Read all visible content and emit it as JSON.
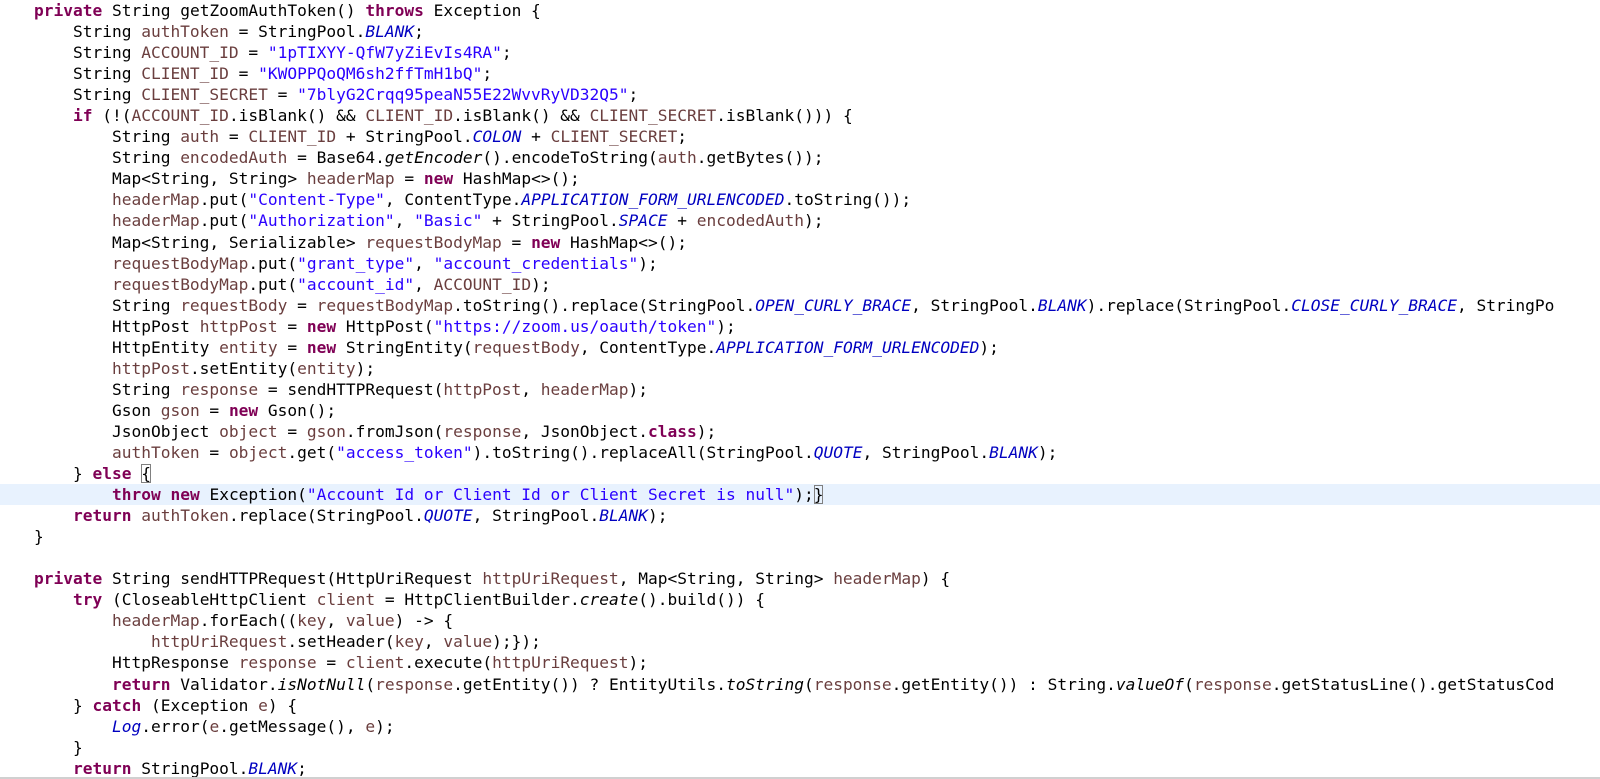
{
  "editor": {
    "language": "java",
    "current_line_index": 23,
    "colors": {
      "keyword": "#7f0055",
      "string": "#2a00ff",
      "field": "#0000c0",
      "local_variable": "#6a3e3e",
      "current_line_highlight": "#e8f2fe"
    },
    "lines": [
      [
        [
          "kw",
          "private"
        ],
        [
          "pl",
          " String getZoomAuthToken() "
        ],
        [
          "kw",
          "throws"
        ],
        [
          "pl",
          " Exception {"
        ]
      ],
      [
        [
          "pl",
          "    String "
        ],
        [
          "var",
          "authToken"
        ],
        [
          "pl",
          " = StringPool."
        ],
        [
          "sfld",
          "BLANK"
        ],
        [
          "pl",
          ";"
        ]
      ],
      [
        [
          "pl",
          "    String "
        ],
        [
          "var",
          "ACCOUNT_ID"
        ],
        [
          "pl",
          " = "
        ],
        [
          "str",
          "\"1pTIXYY-QfW7yZiEvIs4RA\""
        ],
        [
          "pl",
          ";"
        ]
      ],
      [
        [
          "pl",
          "    String "
        ],
        [
          "var",
          "CLIENT_ID"
        ],
        [
          "pl",
          " = "
        ],
        [
          "str",
          "\"KWOPPQoQM6sh2ffTmH1bQ\""
        ],
        [
          "pl",
          ";"
        ]
      ],
      [
        [
          "pl",
          "    String "
        ],
        [
          "var",
          "CLIENT_SECRET"
        ],
        [
          "pl",
          " = "
        ],
        [
          "str",
          "\"7blyG2Crqq95peaN55E22WvvRyVD32Q5\""
        ],
        [
          "pl",
          ";"
        ]
      ],
      [
        [
          "pl",
          "    "
        ],
        [
          "kw",
          "if"
        ],
        [
          "pl",
          " (!("
        ],
        [
          "var",
          "ACCOUNT_ID"
        ],
        [
          "pl",
          ".isBlank() && "
        ],
        [
          "var",
          "CLIENT_ID"
        ],
        [
          "pl",
          ".isBlank() && "
        ],
        [
          "var",
          "CLIENT_SECRET"
        ],
        [
          "pl",
          ".isBlank())) {"
        ]
      ],
      [
        [
          "pl",
          "        String "
        ],
        [
          "var",
          "auth"
        ],
        [
          "pl",
          " = "
        ],
        [
          "var",
          "CLIENT_ID"
        ],
        [
          "pl",
          " + StringPool."
        ],
        [
          "sfld",
          "COLON"
        ],
        [
          "pl",
          " + "
        ],
        [
          "var",
          "CLIENT_SECRET"
        ],
        [
          "pl",
          ";"
        ]
      ],
      [
        [
          "pl",
          "        String "
        ],
        [
          "var",
          "encodedAuth"
        ],
        [
          "pl",
          " = Base64."
        ],
        [
          "smeth",
          "getEncoder"
        ],
        [
          "pl",
          "().encodeToString("
        ],
        [
          "var",
          "auth"
        ],
        [
          "pl",
          ".getBytes());"
        ]
      ],
      [
        [
          "pl",
          "        Map<String, String> "
        ],
        [
          "var",
          "headerMap"
        ],
        [
          "pl",
          " = "
        ],
        [
          "kw",
          "new"
        ],
        [
          "pl",
          " HashMap<>();"
        ]
      ],
      [
        [
          "pl",
          "        "
        ],
        [
          "var",
          "headerMap"
        ],
        [
          "pl",
          ".put("
        ],
        [
          "str",
          "\"Content-Type\""
        ],
        [
          "pl",
          ", ContentType."
        ],
        [
          "sfld",
          "APPLICATION_FORM_URLENCODED"
        ],
        [
          "pl",
          ".toString());"
        ]
      ],
      [
        [
          "pl",
          "        "
        ],
        [
          "var",
          "headerMap"
        ],
        [
          "pl",
          ".put("
        ],
        [
          "str",
          "\"Authorization\""
        ],
        [
          "pl",
          ", "
        ],
        [
          "str",
          "\"Basic\""
        ],
        [
          "pl",
          " + StringPool."
        ],
        [
          "sfld",
          "SPACE"
        ],
        [
          "pl",
          " + "
        ],
        [
          "var",
          "encodedAuth"
        ],
        [
          "pl",
          ");"
        ]
      ],
      [
        [
          "pl",
          "        Map<String, Serializable> "
        ],
        [
          "var",
          "requestBodyMap"
        ],
        [
          "pl",
          " = "
        ],
        [
          "kw",
          "new"
        ],
        [
          "pl",
          " HashMap<>();"
        ]
      ],
      [
        [
          "pl",
          "        "
        ],
        [
          "var",
          "requestBodyMap"
        ],
        [
          "pl",
          ".put("
        ],
        [
          "str",
          "\"grant_type\""
        ],
        [
          "pl",
          ", "
        ],
        [
          "str",
          "\"account_credentials\""
        ],
        [
          "pl",
          ");"
        ]
      ],
      [
        [
          "pl",
          "        "
        ],
        [
          "var",
          "requestBodyMap"
        ],
        [
          "pl",
          ".put("
        ],
        [
          "str",
          "\"account_id\""
        ],
        [
          "pl",
          ", "
        ],
        [
          "var",
          "ACCOUNT_ID"
        ],
        [
          "pl",
          ");"
        ]
      ],
      [
        [
          "pl",
          "        String "
        ],
        [
          "var",
          "requestBody"
        ],
        [
          "pl",
          " = "
        ],
        [
          "var",
          "requestBodyMap"
        ],
        [
          "pl",
          ".toString().replace(StringPool."
        ],
        [
          "sfld",
          "OPEN_CURLY_BRACE"
        ],
        [
          "pl",
          ", StringPool."
        ],
        [
          "sfld",
          "BLANK"
        ],
        [
          "pl",
          ").replace(StringPool."
        ],
        [
          "sfld",
          "CLOSE_CURLY_BRACE"
        ],
        [
          "pl",
          ", StringPo"
        ]
      ],
      [
        [
          "pl",
          "        HttpPost "
        ],
        [
          "var",
          "httpPost"
        ],
        [
          "pl",
          " = "
        ],
        [
          "kw",
          "new"
        ],
        [
          "pl",
          " HttpPost("
        ],
        [
          "str",
          "\"https://zoom.us/oauth/token\""
        ],
        [
          "pl",
          ");"
        ]
      ],
      [
        [
          "pl",
          "        HttpEntity "
        ],
        [
          "var",
          "entity"
        ],
        [
          "pl",
          " = "
        ],
        [
          "kw",
          "new"
        ],
        [
          "pl",
          " StringEntity("
        ],
        [
          "var",
          "requestBody"
        ],
        [
          "pl",
          ", ContentType."
        ],
        [
          "sfld",
          "APPLICATION_FORM_URLENCODED"
        ],
        [
          "pl",
          ");"
        ]
      ],
      [
        [
          "pl",
          "        "
        ],
        [
          "var",
          "httpPost"
        ],
        [
          "pl",
          ".setEntity("
        ],
        [
          "var",
          "entity"
        ],
        [
          "pl",
          ");"
        ]
      ],
      [
        [
          "pl",
          "        String "
        ],
        [
          "var",
          "response"
        ],
        [
          "pl",
          " = sendHTTPRequest("
        ],
        [
          "var",
          "httpPost"
        ],
        [
          "pl",
          ", "
        ],
        [
          "var",
          "headerMap"
        ],
        [
          "pl",
          ");"
        ]
      ],
      [
        [
          "pl",
          "        Gson "
        ],
        [
          "var",
          "gson"
        ],
        [
          "pl",
          " = "
        ],
        [
          "kw",
          "new"
        ],
        [
          "pl",
          " Gson();"
        ]
      ],
      [
        [
          "pl",
          "        JsonObject "
        ],
        [
          "var",
          "object"
        ],
        [
          "pl",
          " = "
        ],
        [
          "var",
          "gson"
        ],
        [
          "pl",
          ".fromJson("
        ],
        [
          "var",
          "response"
        ],
        [
          "pl",
          ", JsonObject."
        ],
        [
          "kw",
          "class"
        ],
        [
          "pl",
          ");"
        ]
      ],
      [
        [
          "pl",
          "        "
        ],
        [
          "var",
          "authToken"
        ],
        [
          "pl",
          " = "
        ],
        [
          "var",
          "object"
        ],
        [
          "pl",
          ".get("
        ],
        [
          "str",
          "\"access_token\""
        ],
        [
          "pl",
          ").toString().replaceAll(StringPool."
        ],
        [
          "sfld",
          "QUOTE"
        ],
        [
          "pl",
          ", StringPool."
        ],
        [
          "sfld",
          "BLANK"
        ],
        [
          "pl",
          ");"
        ]
      ],
      [
        [
          "pl",
          "    } "
        ],
        [
          "kw",
          "else"
        ],
        [
          "pl",
          " "
        ],
        [
          "bracket",
          "{"
        ]
      ],
      [
        [
          "pl",
          "        "
        ],
        [
          "kw",
          "throw"
        ],
        [
          "pl",
          " "
        ],
        [
          "kw",
          "new"
        ],
        [
          "pl",
          " Exception("
        ],
        [
          "str",
          "\"Account Id or Client Id or Client Secret is null\""
        ],
        [
          "pl",
          ");"
        ],
        [
          "caret",
          ""
        ],
        [
          "bracket",
          "}"
        ]
      ],
      [
        [
          "pl",
          "    "
        ],
        [
          "kw",
          "return"
        ],
        [
          "pl",
          " "
        ],
        [
          "var",
          "authToken"
        ],
        [
          "pl",
          ".replace(StringPool."
        ],
        [
          "sfld",
          "QUOTE"
        ],
        [
          "pl",
          ", StringPool."
        ],
        [
          "sfld",
          "BLANK"
        ],
        [
          "pl",
          ");"
        ]
      ],
      [
        [
          "pl",
          "}"
        ]
      ],
      [
        [
          "pl",
          ""
        ]
      ],
      [
        [
          "kw",
          "private"
        ],
        [
          "pl",
          " String sendHTTPRequest(HttpUriRequest "
        ],
        [
          "var",
          "httpUriRequest"
        ],
        [
          "pl",
          ", Map<String, String> "
        ],
        [
          "var",
          "headerMap"
        ],
        [
          "pl",
          ") {"
        ]
      ],
      [
        [
          "pl",
          "    "
        ],
        [
          "kw",
          "try"
        ],
        [
          "pl",
          " (CloseableHttpClient "
        ],
        [
          "var",
          "client"
        ],
        [
          "pl",
          " = HttpClientBuilder."
        ],
        [
          "smeth",
          "create"
        ],
        [
          "pl",
          "().build()) {"
        ]
      ],
      [
        [
          "pl",
          "        "
        ],
        [
          "var",
          "headerMap"
        ],
        [
          "pl",
          ".forEach(("
        ],
        [
          "var",
          "key"
        ],
        [
          "pl",
          ", "
        ],
        [
          "var",
          "value"
        ],
        [
          "pl",
          ") -> {"
        ]
      ],
      [
        [
          "pl",
          "            "
        ],
        [
          "var",
          "httpUriRequest"
        ],
        [
          "pl",
          ".setHeader("
        ],
        [
          "var",
          "key"
        ],
        [
          "pl",
          ", "
        ],
        [
          "var",
          "value"
        ],
        [
          "pl",
          ");});"
        ]
      ],
      [
        [
          "pl",
          "        HttpResponse "
        ],
        [
          "var",
          "response"
        ],
        [
          "pl",
          " = "
        ],
        [
          "var",
          "client"
        ],
        [
          "pl",
          ".execute("
        ],
        [
          "var",
          "httpUriRequest"
        ],
        [
          "pl",
          ");"
        ]
      ],
      [
        [
          "pl",
          "        "
        ],
        [
          "kw",
          "return"
        ],
        [
          "pl",
          " Validator."
        ],
        [
          "smeth",
          "isNotNull"
        ],
        [
          "pl",
          "("
        ],
        [
          "var",
          "response"
        ],
        [
          "pl",
          ".getEntity()) ? EntityUtils."
        ],
        [
          "smeth",
          "toString"
        ],
        [
          "pl",
          "("
        ],
        [
          "var",
          "response"
        ],
        [
          "pl",
          ".getEntity()) : String."
        ],
        [
          "smeth",
          "valueOf"
        ],
        [
          "pl",
          "("
        ],
        [
          "var",
          "response"
        ],
        [
          "pl",
          ".getStatusLine().getStatusCod"
        ]
      ],
      [
        [
          "pl",
          "    } "
        ],
        [
          "kw",
          "catch"
        ],
        [
          "pl",
          " (Exception "
        ],
        [
          "var",
          "e"
        ],
        [
          "pl",
          ") {"
        ]
      ],
      [
        [
          "pl",
          "        "
        ],
        [
          "sfld",
          "Log"
        ],
        [
          "pl",
          ".error("
        ],
        [
          "var",
          "e"
        ],
        [
          "pl",
          ".getMessage(), "
        ],
        [
          "var",
          "e"
        ],
        [
          "pl",
          ");"
        ]
      ],
      [
        [
          "pl",
          "    }"
        ]
      ],
      [
        [
          "pl",
          "    "
        ],
        [
          "kw",
          "return"
        ],
        [
          "pl",
          " StringPool."
        ],
        [
          "sfld",
          "BLANK"
        ],
        [
          "pl",
          ";"
        ]
      ]
    ]
  }
}
